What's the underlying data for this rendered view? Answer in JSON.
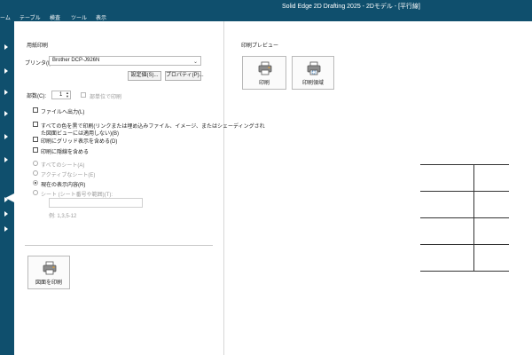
{
  "app": {
    "title": "Solid Edge 2D Drafting 2025 - 2Dモデル - [平行線]"
  },
  "menu": {
    "items": [
      "ーム",
      "テーブル",
      "検査",
      "ツール",
      "表示"
    ]
  },
  "print": {
    "section_title": "用紙印刷",
    "printer_label": "プリンタ(I):",
    "printer_value": "Brother DCP-J926N",
    "settings_button": "設定値(S)...",
    "properties_button": "プロパティ(P)...",
    "copies_label": "部数(C):",
    "copies_value": "1",
    "collate_label": "部単位で印刷",
    "opt_print_to_file": "ファイルへ出力(L)",
    "opt_black_line1": "すべての色を黒で印刷(リンクまたは埋め込みファイル、イメージ、またはシェーディングされ",
    "opt_black_line2": "た図面ビューには適用しない)(B)",
    "opt_grid": "印刷にグリッド表示を含める(D)",
    "opt_hide_lines": "印刷に隠線を含める",
    "range_all_sheets": "すべてのシート(A)",
    "range_active_sheet": "アクティブなシート(E)",
    "range_current_view": "現在の表示内容(R)",
    "range_sheets": "シート (シート番号や範囲)(T):",
    "range_example": "例: 1,3,5-12",
    "print_drawing_button": "図面を印刷"
  },
  "preview": {
    "title": "印刷プレビュー",
    "print_button": "印刷",
    "print_area_button": "印刷領域"
  }
}
